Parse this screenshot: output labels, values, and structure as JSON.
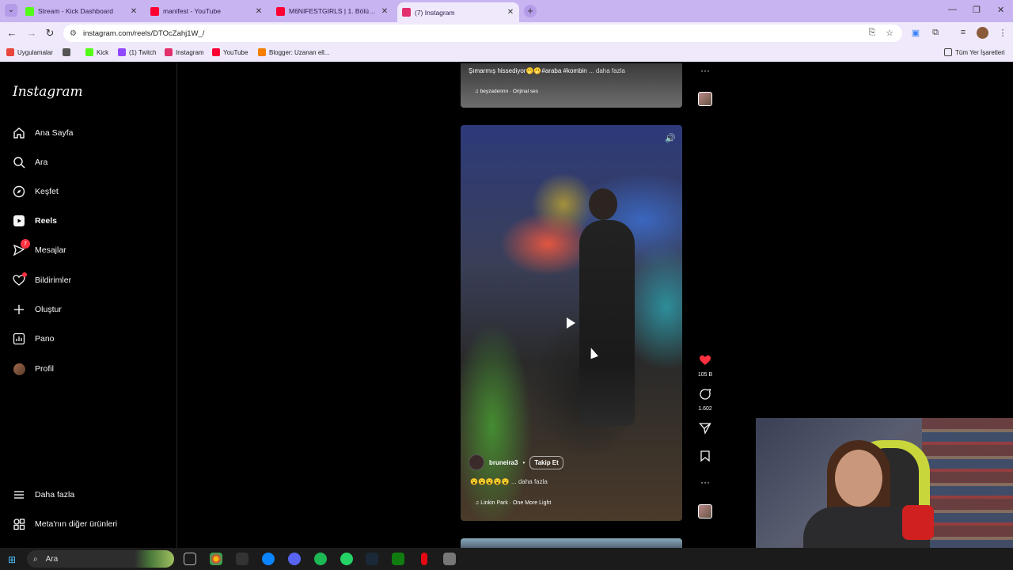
{
  "browser": {
    "tabs": [
      {
        "title": "Stream - Kick Dashboard",
        "color": "#53fc18",
        "active": false
      },
      {
        "title": "manifest - YouTube",
        "color": "#ff0033",
        "active": false
      },
      {
        "title": "M6NIFESTGIRLS | 1. Bölüm - Yo",
        "color": "#ff0033",
        "active": false
      },
      {
        "title": "(7) Instagram",
        "color": "#e1306c",
        "active": true
      }
    ],
    "url": "instagram.com/reels/DTOcZahj1W_/",
    "bookmarks": [
      {
        "label": "Uygulamalar",
        "color": "#e8453c"
      },
      {
        "label": "",
        "color": "#555555"
      },
      {
        "label": "Kick",
        "color": "#53fc18"
      },
      {
        "label": "(1) Twitch",
        "color": "#9146ff"
      },
      {
        "label": "Instagram",
        "color": "#e1306c"
      },
      {
        "label": "YouTube",
        "color": "#ff0033"
      },
      {
        "label": "Blogger: Uzanan ell...",
        "color": "#f57d00"
      }
    ],
    "all_bookmarks": "Tüm Yer İşaretleri"
  },
  "sidebar": {
    "logo": "Instagram",
    "items": [
      {
        "label": "Ana Sayfa",
        "icon": "home-icon"
      },
      {
        "label": "Ara",
        "icon": "search-icon"
      },
      {
        "label": "Keşfet",
        "icon": "compass-icon"
      },
      {
        "label": "Reels",
        "icon": "reels-icon"
      },
      {
        "label": "Mesajlar",
        "icon": "messenger-icon",
        "badge": "7"
      },
      {
        "label": "Bildirimler",
        "icon": "heart-icon"
      },
      {
        "label": "Oluştur",
        "icon": "plus-icon"
      },
      {
        "label": "Pano",
        "icon": "dashboard-icon"
      },
      {
        "label": "Profil",
        "icon": "profile-avatar"
      }
    ],
    "more": "Daha fazla",
    "meta": "Meta'nın diğer ürünleri"
  },
  "feed": {
    "prev_reel": {
      "caption": "Şımarmış hissediyor🫢🫢#araba #kombin",
      "more": "... daha fazla",
      "audio": "beyzadennn · Orijinal ses"
    },
    "reel": {
      "username": "bruneira3",
      "dot": "•",
      "follow": "Takip Et",
      "caption": "😮😮😮😮😮",
      "more": "... daha fazla",
      "audio": "Linkin Park · One More Light"
    },
    "actions": {
      "likes": "105 B",
      "comments": "1.602"
    }
  },
  "taskbar": {
    "search": "Ara"
  }
}
